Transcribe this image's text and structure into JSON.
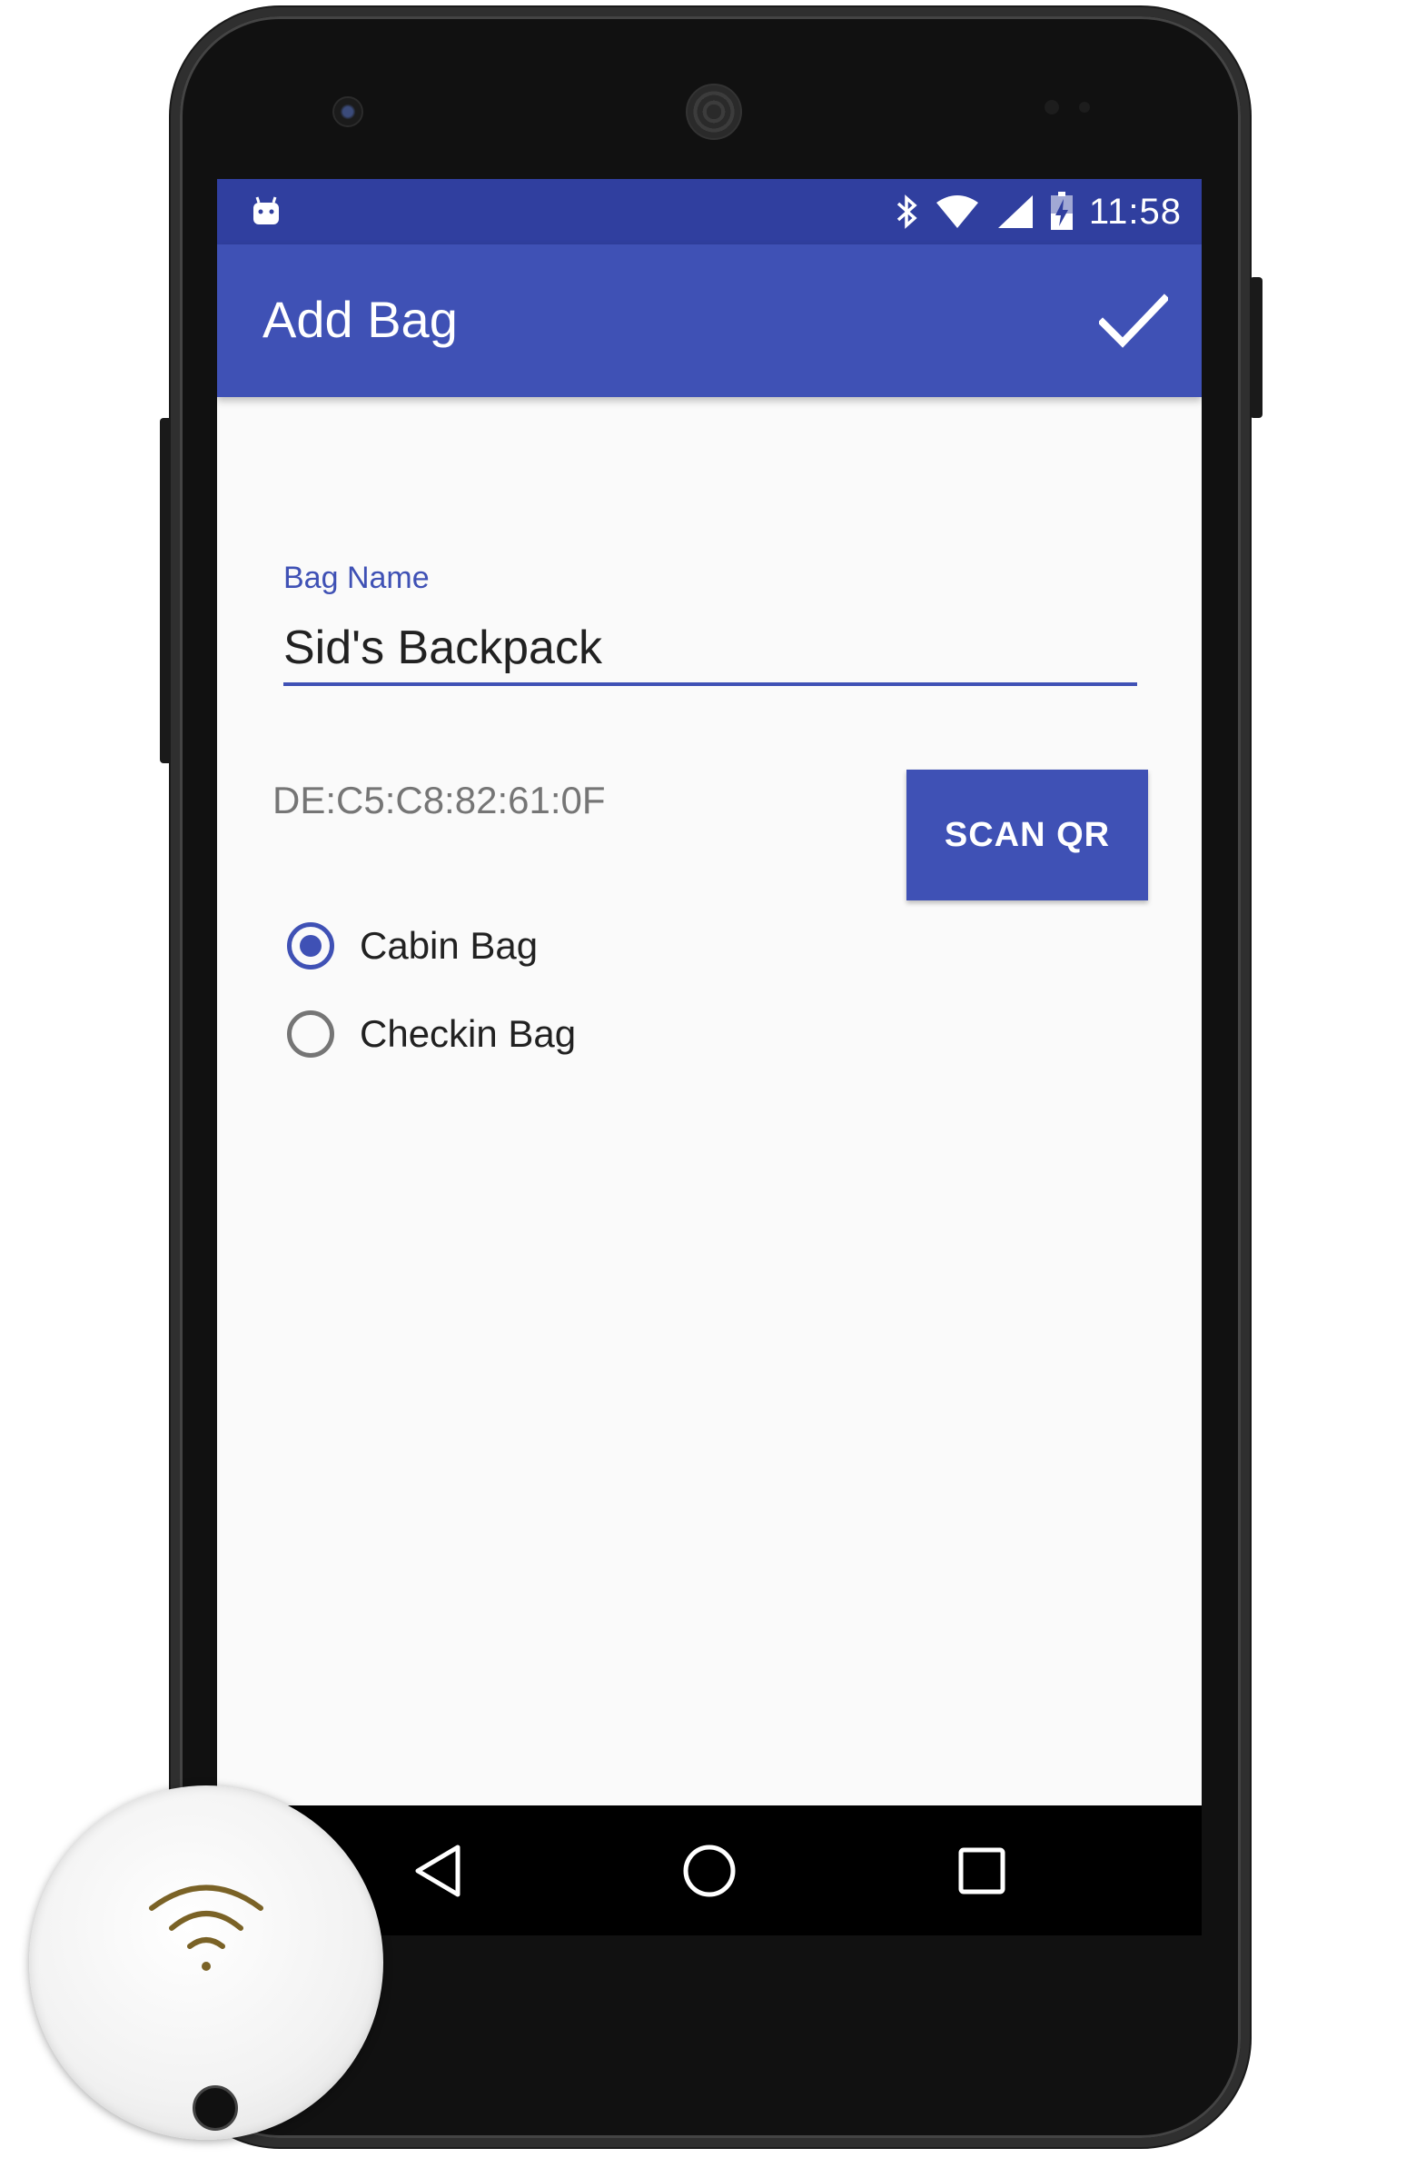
{
  "status_bar": {
    "time": "11:58"
  },
  "app_bar": {
    "title": "Add Bag",
    "done_icon": "check-icon"
  },
  "form": {
    "bag_name_label": "Bag Name",
    "bag_name_value": "Sid's Backpack",
    "mac_address": "DE:C5:C8:82:61:0F",
    "scan_button_label": "SCAN QR",
    "bag_type_options": [
      {
        "label": "Cabin Bag",
        "selected": true
      },
      {
        "label": "Checkin Bag",
        "selected": false
      }
    ]
  },
  "nav_bar": {
    "back_icon": "back-triangle-icon",
    "home_icon": "home-circle-icon",
    "recents_icon": "recents-square-icon"
  },
  "colors": {
    "primary": "#3f51b5",
    "primary_dark": "#303f9f",
    "background": "#fafafa"
  }
}
